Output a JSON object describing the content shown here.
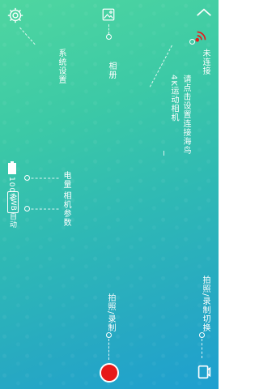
{
  "top_bar": {
    "settings_label": "系统设置",
    "album_label": "相册",
    "hint_text": "请点击设置连接海鸟4K运动相机",
    "wifi_status": "未连接",
    "wifi_status_color": "#e61919"
  },
  "status": {
    "battery_percent": "100%",
    "wb_mode": "AWB",
    "wb_value": "自动",
    "battery_label": "电量",
    "camera_params_label": "相机参数"
  },
  "bottom_bar": {
    "record_label": "拍照/录制",
    "mode_switch_label": "拍照/录制切换",
    "record_color": "#e61919"
  },
  "icons": {
    "settings": "gear-icon",
    "album": "image-icon",
    "collapse": "chevron-up-icon",
    "wifi": "wifi-signal-icon",
    "battery": "battery-icon",
    "record": "record-button",
    "switch": "camera-switch-icon"
  }
}
